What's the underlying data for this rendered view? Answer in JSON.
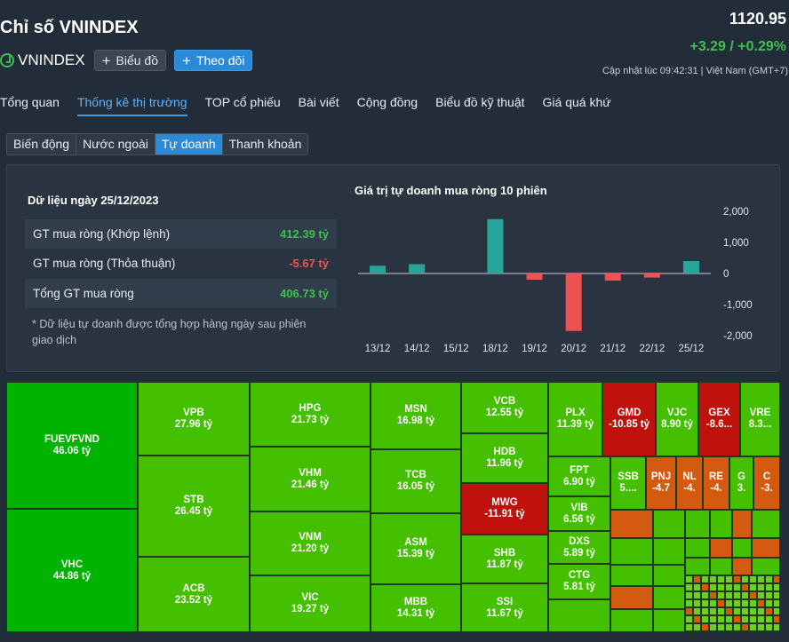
{
  "header": {
    "title": "Chỉ số VNINDEX",
    "symbol": "VNINDEX",
    "chart_button": "Biểu đồ",
    "follow_button": "Theo dõi",
    "price": "1120.95",
    "change": "+3.29 / +0.29%",
    "updated": "Cập nhật lúc  09:42:31 | Việt Nam (GMT+7)"
  },
  "tabs": [
    "Tổng quan",
    "Thống kê thị trường",
    "TOP cổ phiếu",
    "Bài viết",
    "Cộng đồng",
    "Biểu đồ kỹ thuật",
    "Giá quá khứ"
  ],
  "subtabs": [
    "Biến động",
    "Nước ngoài",
    "Tự doanh",
    "Thanh khoản"
  ],
  "summary": {
    "date_label": "Dữ liệu ngày 25/12/2023",
    "rows": [
      {
        "label": "GT mua ròng (Khớp lệnh)",
        "value": "412.39 tỷ"
      },
      {
        "label": "GT mua ròng (Thỏa thuận)",
        "value": "-5.67 tỷ"
      },
      {
        "label": "Tổng GT mua ròng",
        "value": "406.73 tỷ"
      }
    ],
    "note": "* Dữ liệu tự doanh được tổng hợp hàng ngày sau phiên giao dịch"
  },
  "chart_data": {
    "type": "bar",
    "title": "Giá trị tự doanh mua ròng 10 phiên",
    "categories": [
      "13/12",
      "14/12",
      "15/12",
      "18/12",
      "19/12",
      "20/12",
      "21/12",
      "22/12",
      "25/12"
    ],
    "values": [
      250,
      300,
      0,
      1750,
      -200,
      -1850,
      -230,
      -130,
      400
    ],
    "ylim": [
      -2000,
      2000
    ],
    "yticks": [
      2000,
      1000,
      0,
      -1000,
      -2000
    ],
    "ytick_labels": [
      "2,000",
      "1,000",
      "0",
      "-1,000",
      "-2,000"
    ],
    "colors": {
      "positive": "#26a69a",
      "negative": "#ef5350"
    }
  },
  "treemap": [
    {
      "sym": "FUEVFVND",
      "val": "46.06 tỷ"
    },
    {
      "sym": "VHC",
      "val": "44.86 tỷ"
    },
    {
      "sym": "VPB",
      "val": "27.96 tỷ"
    },
    {
      "sym": "STB",
      "val": "26.45 tỷ"
    },
    {
      "sym": "ACB",
      "val": "23.52 tỷ"
    },
    {
      "sym": "HPG",
      "val": "21.73 tỷ"
    },
    {
      "sym": "VHM",
      "val": "21.46 tỷ"
    },
    {
      "sym": "VNM",
      "val": "21.20 tỷ"
    },
    {
      "sym": "VIC",
      "val": "19.27 tỷ"
    },
    {
      "sym": "MSN",
      "val": "16.98 tỷ"
    },
    {
      "sym": "TCB",
      "val": "16.05 tỷ"
    },
    {
      "sym": "ASM",
      "val": "15.39 tỷ"
    },
    {
      "sym": "MBB",
      "val": "14.31 tỷ"
    },
    {
      "sym": "VCB",
      "val": "12.55 tỷ"
    },
    {
      "sym": "HDB",
      "val": "11.96 tỷ"
    },
    {
      "sym": "MWG",
      "val": "-11.91 tỷ"
    },
    {
      "sym": "SHB",
      "val": "11.87 tỷ"
    },
    {
      "sym": "SSI",
      "val": "11.67 tỷ"
    },
    {
      "sym": "PLX",
      "val": "11.39 tỷ"
    },
    {
      "sym": "GMD",
      "val": "-10.85 tỷ"
    },
    {
      "sym": "VJC",
      "val": "8.90 tỷ"
    },
    {
      "sym": "GEX",
      "val": "-8.6..."
    },
    {
      "sym": "VRE",
      "val": "8.3..."
    },
    {
      "sym": "FPT",
      "val": "6.90 tỷ"
    },
    {
      "sym": "SSB",
      "val": "5...."
    },
    {
      "sym": "PNJ",
      "val": "-4.7"
    },
    {
      "sym": "NL",
      "val": "-4."
    },
    {
      "sym": "RE",
      "val": "-4."
    },
    {
      "sym": "G",
      "val": "3."
    },
    {
      "sym": "C",
      "val": "-3."
    },
    {
      "sym": "VIB",
      "val": "6.56 tỷ"
    },
    {
      "sym": "DXS",
      "val": "5.89 tỷ"
    },
    {
      "sym": "CTG",
      "val": "5.81 tỷ"
    }
  ],
  "colors": {
    "green_strong": "#00b300",
    "green": "#44c000",
    "green_light": "#6ccf22",
    "red_strong": "#c0120d",
    "red": "#d45a10"
  }
}
